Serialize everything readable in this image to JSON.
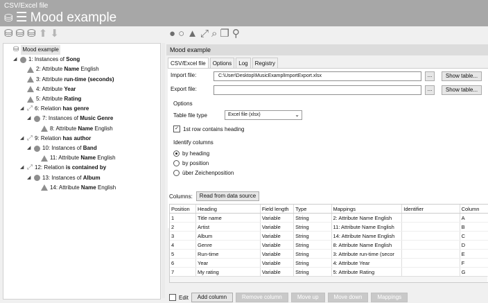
{
  "window": {
    "subtitle": "CSV/Excel file",
    "title": "Mood example",
    "title_icons": "☰"
  },
  "toolbar": {
    "left_icons": [
      "db-add-icon",
      "db-add-icon",
      "db-add-icon",
      "arrow-up-icon",
      "arrow-down-icon"
    ],
    "right_icons": [
      "circle-icon",
      "circle-outline-icon",
      "triangle-icon",
      "relation-icon",
      "search-icon",
      "folder-icon",
      "magnifier-icon"
    ]
  },
  "tree": {
    "items": [
      {
        "indent": 0,
        "icon": "db",
        "pre": "Mood example",
        "bold": "",
        "post": "",
        "root": true
      },
      {
        "indent": 1,
        "icon": "circle",
        "tog": "◢",
        "pre": "1: Instances of ",
        "bold": "Song",
        "post": ""
      },
      {
        "indent": 2,
        "icon": "tri",
        "pre": "2: Attribute ",
        "bold": "Name",
        "post": " English"
      },
      {
        "indent": 2,
        "icon": "tri",
        "pre": "3: Attribute ",
        "bold": "run-time (seconds)",
        "post": ""
      },
      {
        "indent": 2,
        "icon": "tri",
        "pre": "4: Attribute ",
        "bold": "Year",
        "post": ""
      },
      {
        "indent": 2,
        "icon": "tri",
        "pre": "5: Attribute ",
        "bold": "Rating",
        "post": ""
      },
      {
        "indent": 2,
        "icon": "rel",
        "tog": "◢",
        "pre": "6: Relation ",
        "bold": "has genre",
        "post": ""
      },
      {
        "indent": 3,
        "icon": "circle",
        "tog": "◢",
        "pre": "7: Instances of ",
        "bold": "Music Genre",
        "post": ""
      },
      {
        "indent": 4,
        "icon": "tri",
        "pre": "8: Attribute ",
        "bold": "Name",
        "post": " English"
      },
      {
        "indent": 2,
        "icon": "rel",
        "tog": "◢",
        "pre": "9: Relation ",
        "bold": "has author",
        "post": ""
      },
      {
        "indent": 3,
        "icon": "circle",
        "tog": "◢",
        "pre": "10: Instances of ",
        "bold": "Band",
        "post": ""
      },
      {
        "indent": 4,
        "icon": "tri",
        "pre": "11: Attribute ",
        "bold": "Name",
        "post": " English"
      },
      {
        "indent": 2,
        "icon": "rel",
        "tog": "◢",
        "pre": "12: Relation ",
        "bold": "is contained by",
        "post": ""
      },
      {
        "indent": 3,
        "icon": "circle",
        "tog": "◢",
        "pre": "13: Instances of ",
        "bold": "Album",
        "post": ""
      },
      {
        "indent": 4,
        "icon": "tri",
        "pre": "14: Attribute ",
        "bold": "Name",
        "post": " English"
      }
    ]
  },
  "panel": {
    "header": "Mood example",
    "tabs": [
      "CSV/Excel file",
      "Options",
      "Log",
      "Registry"
    ],
    "import_label": "Import file:",
    "import_value": "C:\\User\\Desktop\\MusicExamplImportExport.xlsx",
    "export_label": "Export file:",
    "export_value": "",
    "dots": "...",
    "show_table": "Show table...",
    "options_label": "Options",
    "table_type_label": "Table file type",
    "table_type_value": "Excel file (xlsx)",
    "heading_check": "1st row contains heading",
    "identify_label": "Identify columns",
    "radio": [
      "by heading",
      "by position",
      "über Zeichenposition"
    ],
    "columns_label": "Columns:",
    "read_button": "Read from data source"
  },
  "grid": {
    "headers": [
      "Position",
      "Heading",
      "Field length",
      "Type",
      "Mappings",
      "Identifier",
      "Column"
    ],
    "rows": [
      [
        "1",
        "Title name",
        "Variable",
        "String",
        "2: Attribute Name English",
        "",
        "A"
      ],
      [
        "2",
        "Artist",
        "Variable",
        "String",
        "11: Attribute Name English",
        "",
        "B"
      ],
      [
        "3",
        "Album",
        "Variable",
        "String",
        "14: Attribute Name English",
        "",
        "C"
      ],
      [
        "4",
        "Genre",
        "Variable",
        "String",
        "8: Attribute Name English",
        "",
        "D"
      ],
      [
        "5",
        "Run-time",
        "Variable",
        "String",
        "3: Attribute run-time (secor",
        "",
        "E"
      ],
      [
        "6",
        "Year",
        "Variable",
        "String",
        "4: Attribute Year",
        "",
        "F"
      ],
      [
        "7",
        "My rating",
        "Variable",
        "String",
        "5: Attribute Rating",
        "",
        "G"
      ]
    ]
  },
  "bottom": {
    "edit_label": "Edit",
    "buttons": [
      {
        "label": "Add column",
        "enabled": true
      },
      {
        "label": "Remove column",
        "enabled": false
      },
      {
        "label": "Move up",
        "enabled": false
      },
      {
        "label": "Move down",
        "enabled": false
      },
      {
        "label": "Mappings",
        "enabled": false
      }
    ]
  }
}
